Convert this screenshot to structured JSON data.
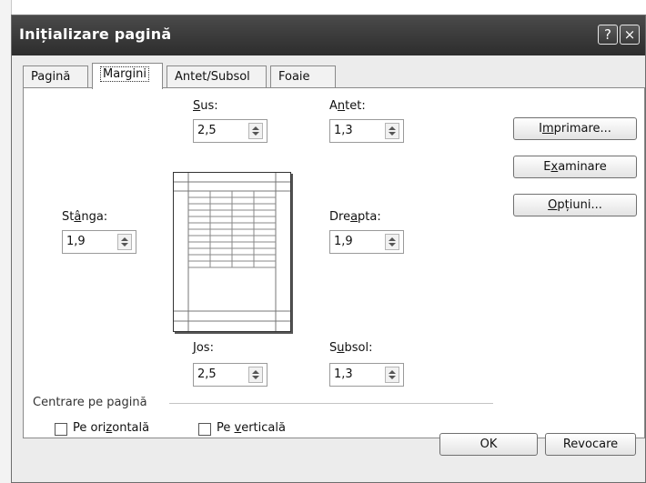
{
  "window": {
    "title": "Inițializare pagină",
    "help_glyph": "?",
    "close_glyph": "×"
  },
  "tabs": [
    {
      "label": "Pagină"
    },
    {
      "label": "Margini"
    },
    {
      "label": "Antet/Subsol"
    },
    {
      "label": "Foaie"
    }
  ],
  "margins": {
    "top": {
      "label_u": "S",
      "label_rest": "us:",
      "value": "2,5"
    },
    "header": {
      "label_pre": "A",
      "label_u": "n",
      "label_rest": "tet:",
      "value": "1,3"
    },
    "left": {
      "label_pre": "St",
      "label_u": "â",
      "label_rest": "nga:",
      "value": "1,9"
    },
    "right": {
      "label_pre": "Dre",
      "label_u": "a",
      "label_rest": "pta:",
      "value": "1,9"
    },
    "bottom": {
      "label_u": "J",
      "label_rest": "os:",
      "value": "2,5"
    },
    "footer": {
      "label_pre": "S",
      "label_u": "u",
      "label_rest": "bsol:",
      "value": "1,3"
    }
  },
  "side_buttons": {
    "print": {
      "pre": "I",
      "u": "m",
      "rest": "primare..."
    },
    "preview": {
      "pre": "E",
      "u": "x",
      "rest": "aminare"
    },
    "options": {
      "pre": "",
      "u": "O",
      "rest": "pțiuni..."
    }
  },
  "center": {
    "group_label": "Centrare pe pagină",
    "horizontal": {
      "pre": "Pe ori",
      "u": "z",
      "rest": "ontală",
      "checked": false
    },
    "vertical": {
      "pre": "Pe ",
      "u": "v",
      "rest": "erticală",
      "checked": false
    }
  },
  "footer_buttons": {
    "ok": "OK",
    "cancel": "Revocare"
  }
}
